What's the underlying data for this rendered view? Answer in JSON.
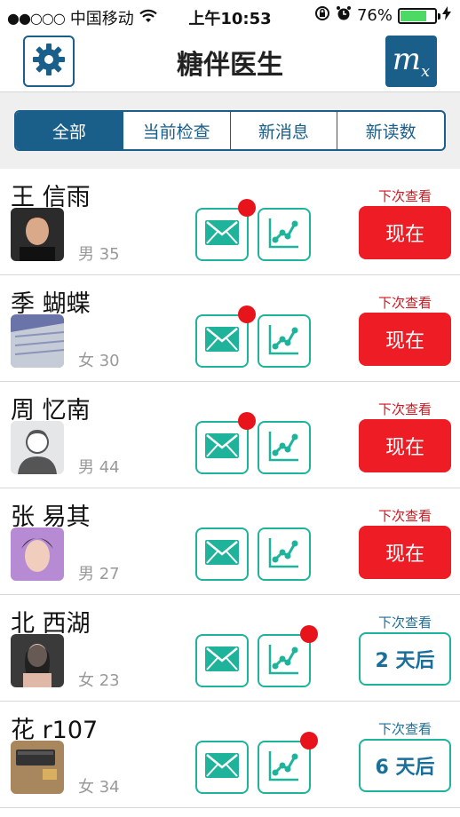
{
  "statusbar": {
    "carrier": "中国移动",
    "time": "上午10:53",
    "battery": "76%",
    "battery_level": 0.76
  },
  "header": {
    "title": "糖伴医生",
    "settings_icon": "gear-icon",
    "right_icon_text": "m",
    "right_icon_sub": "x"
  },
  "tabs": [
    {
      "label": "全部",
      "active": true
    },
    {
      "label": "当前检查"
    },
    {
      "label": "新消息"
    },
    {
      "label": "新读数"
    }
  ],
  "patients": [
    {
      "name": "王 信雨",
      "meta": "男 35",
      "next_label": "下次查看",
      "next_value": "现在",
      "state": "red",
      "mail_badge": true,
      "chart_badge": false
    },
    {
      "name": "季 蝴蝶",
      "meta": "女 30",
      "next_label": "下次查看",
      "next_value": "现在",
      "state": "red",
      "mail_badge": true,
      "chart_badge": false
    },
    {
      "name": "周 忆南",
      "meta": "男 44",
      "next_label": "下次查看",
      "next_value": "现在",
      "state": "red",
      "mail_badge": true,
      "chart_badge": false
    },
    {
      "name": "张 易其",
      "meta": "男 27",
      "next_label": "下次查看",
      "next_value": "现在",
      "state": "red",
      "mail_badge": false,
      "chart_badge": false
    },
    {
      "name": "北 西湖",
      "meta": "女 23",
      "next_label": "下次查看",
      "next_value": "2 天后",
      "state": "teal",
      "mail_badge": false,
      "chart_badge": true
    },
    {
      "name": "花 r107",
      "meta": "女 34",
      "next_label": "下次查看",
      "next_value": "6 天后",
      "state": "teal",
      "mail_badge": false,
      "chart_badge": true
    }
  ],
  "colors": {
    "primary": "#1a5e8a",
    "teal": "#1fb39b",
    "alert": "#ee1c24"
  }
}
